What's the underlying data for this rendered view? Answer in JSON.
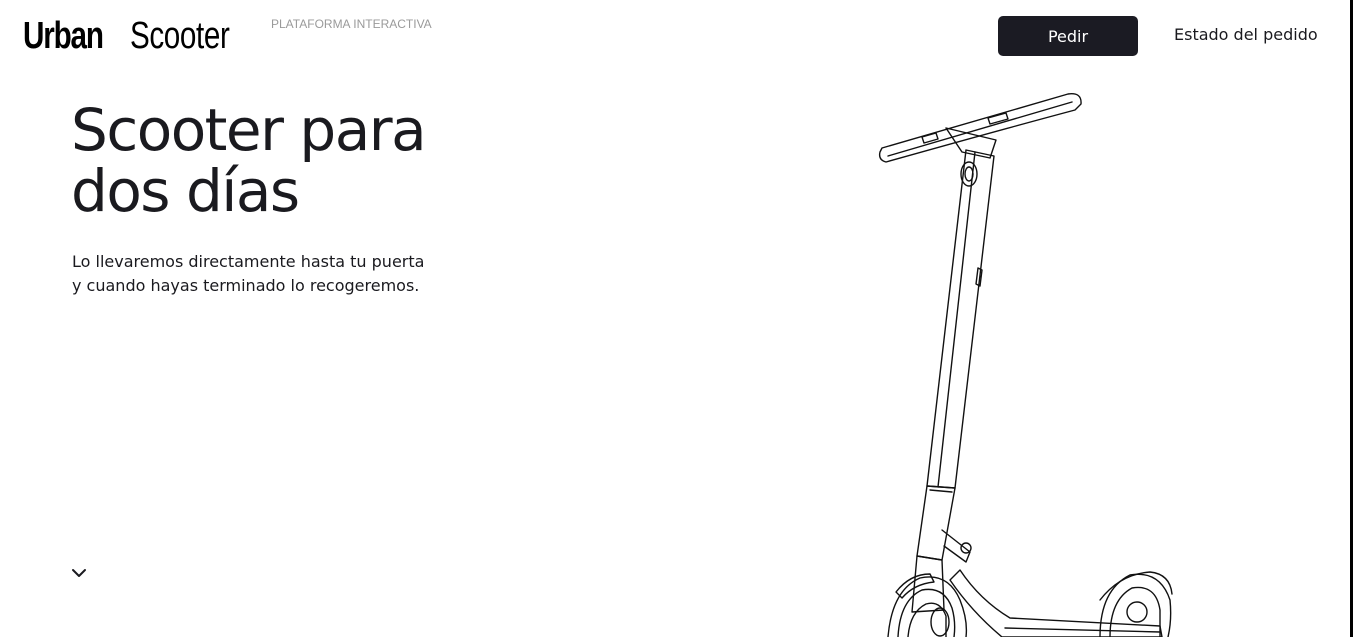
{
  "header": {
    "logo_bold": "Urban",
    "logo_light": "Scooter",
    "logo_tag": "PLATAFORMA INTERACTIVA",
    "order_button": "Pedir",
    "order_status_link": "Estado del pedido"
  },
  "hero": {
    "title_line1": "Scooter para",
    "title_line2": "dos días",
    "subtitle_line1": "Lo llevaremos directamente hasta tu puerta",
    "subtitle_line2": "y cuando hayas terminado lo recogeremos."
  },
  "icons": {
    "scroll": "chevron-down-icon",
    "illustration": "scooter-illustration"
  },
  "colors": {
    "primary_button": "#1b1b23",
    "text": "#1a1a1f",
    "tag": "#9a9a9a"
  }
}
